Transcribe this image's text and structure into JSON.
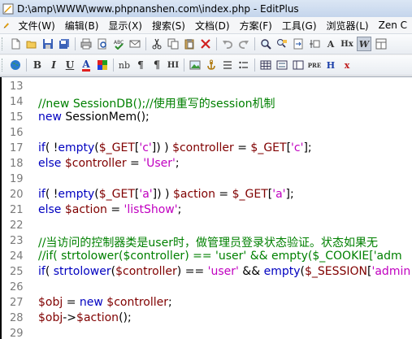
{
  "title": "D:\\amp\\WWW\\www.phpnanshen.com\\index.php - EditPlus",
  "menu": [
    "文件(W)",
    "编辑(B)",
    "显示(X)",
    "搜索(S)",
    "文档(D)",
    "方案(F)",
    "工具(G)",
    "浏览器(L)",
    "Zen C"
  ],
  "toolbar2_labels": {
    "bold": "B",
    "italic": "I",
    "underline": "U",
    "font_color": "A",
    "nb": "nb",
    "pipe": "¶",
    "hr": "HI",
    "pre": "PRE",
    "h": "H",
    "x": "x"
  },
  "colors": {
    "comment": "#008000",
    "keyword": "#0000c0",
    "variable": "#800000",
    "string": "#c000c0"
  },
  "lines": [
    {
      "n": "13",
      "t": []
    },
    {
      "n": "14",
      "t": [
        {
          "c": "cm",
          "s": "//new SessionDB();//使用重写的session机制"
        }
      ]
    },
    {
      "n": "15",
      "t": [
        {
          "c": "kw",
          "s": "new "
        },
        {
          "c": "pl",
          "s": "SessionMem();"
        }
      ]
    },
    {
      "n": "16",
      "t": []
    },
    {
      "n": "17",
      "t": [
        {
          "c": "kw",
          "s": "if"
        },
        {
          "c": "pl",
          "s": "( !"
        },
        {
          "c": "kw",
          "s": "empty"
        },
        {
          "c": "pl",
          "s": "("
        },
        {
          "c": "vr",
          "s": "$_GET"
        },
        {
          "c": "pl",
          "s": "["
        },
        {
          "c": "st",
          "s": "'c'"
        },
        {
          "c": "pl",
          "s": "]) ) "
        },
        {
          "c": "vr",
          "s": "$controller"
        },
        {
          "c": "pl",
          "s": " = "
        },
        {
          "c": "vr",
          "s": "$_GET"
        },
        {
          "c": "pl",
          "s": "["
        },
        {
          "c": "st",
          "s": "'c'"
        },
        {
          "c": "pl",
          "s": "];"
        }
      ]
    },
    {
      "n": "18",
      "t": [
        {
          "c": "kw",
          "s": "else "
        },
        {
          "c": "vr",
          "s": "$controller"
        },
        {
          "c": "pl",
          "s": " = "
        },
        {
          "c": "st",
          "s": "'User'"
        },
        {
          "c": "pl",
          "s": ";"
        }
      ]
    },
    {
      "n": "19",
      "t": []
    },
    {
      "n": "20",
      "t": [
        {
          "c": "kw",
          "s": "if"
        },
        {
          "c": "pl",
          "s": "( !"
        },
        {
          "c": "kw",
          "s": "empty"
        },
        {
          "c": "pl",
          "s": "("
        },
        {
          "c": "vr",
          "s": "$_GET"
        },
        {
          "c": "pl",
          "s": "["
        },
        {
          "c": "st",
          "s": "'a'"
        },
        {
          "c": "pl",
          "s": "]) ) "
        },
        {
          "c": "vr",
          "s": "$action"
        },
        {
          "c": "pl",
          "s": " = "
        },
        {
          "c": "vr",
          "s": "$_GET"
        },
        {
          "c": "pl",
          "s": "["
        },
        {
          "c": "st",
          "s": "'a'"
        },
        {
          "c": "pl",
          "s": "];"
        }
      ]
    },
    {
      "n": "21",
      "t": [
        {
          "c": "kw",
          "s": "else "
        },
        {
          "c": "vr",
          "s": "$action"
        },
        {
          "c": "pl",
          "s": " = "
        },
        {
          "c": "st",
          "s": "'listShow'"
        },
        {
          "c": "pl",
          "s": ";"
        }
      ]
    },
    {
      "n": "22",
      "t": []
    },
    {
      "n": "23",
      "t": [
        {
          "c": "cm",
          "s": "//当访问的控制器类是user时，做管理员登录状态验证。状态如果无"
        }
      ]
    },
    {
      "n": "24",
      "t": [
        {
          "c": "cm",
          "s": "//if( strtolower($controller) == 'user' && empty($_COOKIE['adm"
        }
      ]
    },
    {
      "n": "25",
      "t": [
        {
          "c": "kw",
          "s": "if"
        },
        {
          "c": "pl",
          "s": "( "
        },
        {
          "c": "kw",
          "s": "strtolower"
        },
        {
          "c": "pl",
          "s": "("
        },
        {
          "c": "vr",
          "s": "$controller"
        },
        {
          "c": "pl",
          "s": ") == "
        },
        {
          "c": "st",
          "s": "'user'"
        },
        {
          "c": "pl",
          "s": " && "
        },
        {
          "c": "kw",
          "s": "empty"
        },
        {
          "c": "pl",
          "s": "("
        },
        {
          "c": "vr",
          "s": "$_SESSION"
        },
        {
          "c": "pl",
          "s": "["
        },
        {
          "c": "st",
          "s": "'admin"
        }
      ]
    },
    {
      "n": "26",
      "t": []
    },
    {
      "n": "27",
      "t": [
        {
          "c": "vr",
          "s": "$obj"
        },
        {
          "c": "pl",
          "s": " = "
        },
        {
          "c": "kw",
          "s": "new "
        },
        {
          "c": "vr",
          "s": "$controller"
        },
        {
          "c": "pl",
          "s": ";"
        }
      ]
    },
    {
      "n": "28",
      "t": [
        {
          "c": "vr",
          "s": "$obj"
        },
        {
          "c": "pl",
          "s": "->"
        },
        {
          "c": "vr",
          "s": "$action"
        },
        {
          "c": "pl",
          "s": "();"
        }
      ]
    },
    {
      "n": "29",
      "t": []
    }
  ]
}
